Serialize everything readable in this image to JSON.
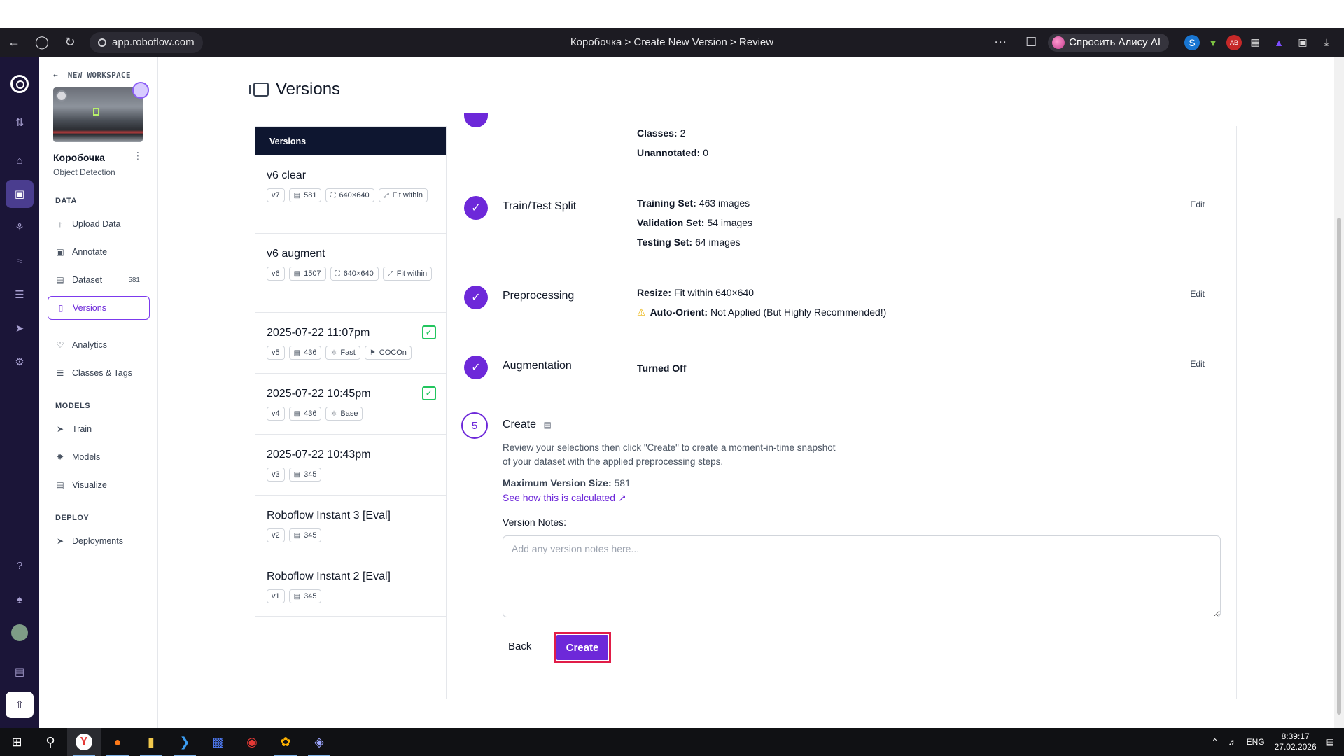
{
  "browser": {
    "url": "app.roboflow.com",
    "tab_title": "Коробочка > Create New Version > Review",
    "alice_label": "Спросить Алису AI"
  },
  "rail": {
    "icons": [
      "home-icon",
      "upload-icon",
      "dataset-icon",
      "workflow-icon",
      "chart-icon",
      "layers-icon",
      "rocket-icon",
      "settings-icon",
      "help-icon",
      "bell-icon",
      "avatar",
      "docs-icon",
      "export-icon"
    ]
  },
  "sidebar": {
    "back_label": "NEW WORKSPACE",
    "project_name": "Коробочка",
    "project_type": "Object Detection",
    "data_heading": "DATA",
    "models_heading": "MODELS",
    "deploy_heading": "DEPLOY",
    "items": [
      {
        "label": "Upload Data"
      },
      {
        "label": "Annotate"
      },
      {
        "label": "Dataset",
        "count": "581"
      },
      {
        "label": "Versions"
      },
      {
        "label": "Analytics"
      },
      {
        "label": "Classes & Tags"
      },
      {
        "label": "Train"
      },
      {
        "label": "Models"
      },
      {
        "label": "Visualize"
      },
      {
        "label": "Deployments"
      }
    ]
  },
  "page": {
    "title": "Versions"
  },
  "versions_list": {
    "header": "Versions",
    "items": [
      {
        "name": "v6 clear",
        "tags": [
          "v7",
          "581",
          "640×640",
          "Fit within"
        ]
      },
      {
        "name": "v6 augment",
        "tags": [
          "v6",
          "1507",
          "640×640",
          "Fit within"
        ]
      },
      {
        "name": "2025-07-22 11:07pm",
        "tags": [
          "v5",
          "436",
          "Fast",
          "COCOn"
        ]
      },
      {
        "name": "2025-07-22 10:45pm",
        "tags": [
          "v4",
          "436",
          "Base"
        ]
      },
      {
        "name": "2025-07-22 10:43pm",
        "tags": [
          "v3",
          "345"
        ]
      },
      {
        "name": "Roboflow Instant 3 [Eval]",
        "tags": [
          "v2",
          "345"
        ]
      },
      {
        "name": "Roboflow Instant 2 [Eval]",
        "tags": [
          "v1",
          "345"
        ]
      }
    ]
  },
  "review": {
    "source": {
      "classes_label": "Classes:",
      "classes_value": "2",
      "unannotated_label": "Unannotated:",
      "unannotated_value": "0"
    },
    "split": {
      "title": "Train/Test Split",
      "training_label": "Training Set:",
      "training_value": "463 images",
      "validation_label": "Validation Set:",
      "validation_value": "54 images",
      "testing_label": "Testing Set:",
      "testing_value": "64 images",
      "edit": "Edit"
    },
    "preprocessing": {
      "title": "Preprocessing",
      "resize_label": "Resize:",
      "resize_value": "Fit within 640×640",
      "orient_label": "Auto-Orient:",
      "orient_value": "Not Applied (But Highly Recommended!)",
      "edit": "Edit"
    },
    "augmentation": {
      "title": "Augmentation",
      "value": "Turned Off",
      "edit": "Edit"
    },
    "create": {
      "step_number": "5",
      "title": "Create",
      "description": "Review your selections then click \"Create\" to create a moment-in-time snapshot of your dataset with the applied preprocessing steps.",
      "max_size_label": "Maximum Version Size:",
      "max_size_value": "581",
      "calc_link": "See how this is calculated",
      "notes_label": "Version Notes:",
      "notes_placeholder": "Add any version notes here...",
      "back_label": "Back",
      "create_label": "Create"
    }
  },
  "taskbar": {
    "lang": "ENG",
    "time": "8:39:17",
    "date": "27.02.2026"
  },
  "colors": {
    "accent": "#6d28d9",
    "rail_bg": "#1b1538",
    "list_header_bg": "#0e1630",
    "highlight_border": "#e11d48"
  }
}
